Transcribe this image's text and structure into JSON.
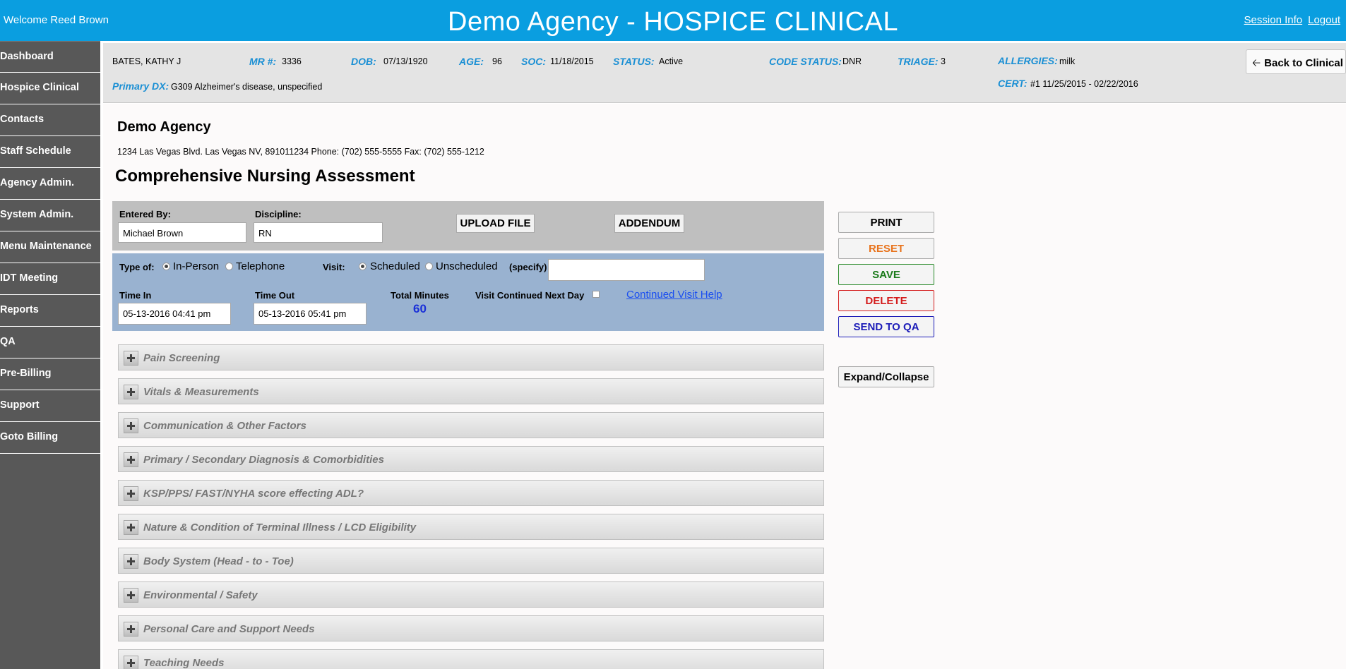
{
  "header": {
    "welcome": "Welcome Reed Brown",
    "title": "Demo Agency - HOSPICE CLINICAL",
    "session_info": "Session Info",
    "logout": "Logout"
  },
  "sidebar": {
    "items": [
      {
        "label": "Dashboard"
      },
      {
        "label": "Hospice Clinical"
      },
      {
        "label": "Contacts"
      },
      {
        "label": "Staff Schedule"
      },
      {
        "label": "Agency Admin."
      },
      {
        "label": "System Admin."
      },
      {
        "label": "Menu Maintenance"
      },
      {
        "label": "IDT Meeting"
      },
      {
        "label": "Reports"
      },
      {
        "label": "QA"
      },
      {
        "label": "Pre-Billing"
      },
      {
        "label": "Support"
      },
      {
        "label": "Goto Billing"
      }
    ]
  },
  "patient": {
    "name": "BATES, KATHY J",
    "mr_label": "MR #:",
    "mr": "3336",
    "dob_label": "DOB:",
    "dob": "07/13/1920",
    "age_label": "AGE:",
    "age": "96",
    "soc_label": "SOC:",
    "soc": "11/18/2015",
    "status_label": "STATUS:",
    "status": "Active",
    "code_status_label": "CODE STATUS:",
    "code_status": "DNR",
    "triage_label": "TRIAGE:",
    "triage": "3",
    "allergies_label": "ALLERGIES:",
    "allergies": "milk",
    "primary_dx_label": "Primary DX:",
    "primary_dx": "G309 Alzheimer's disease, unspecified",
    "cert_label": "CERT:",
    "cert": "#1 11/25/2015 - 02/22/2016",
    "back_button": "Back to Clinical"
  },
  "agency": {
    "name": "Demo Agency",
    "address": "1234 Las Vegas Blvd. Las Vegas NV, 891011234 Phone: (702) 555-5555 Fax: (702) 555-1212"
  },
  "page_title": "Comprehensive Nursing Assessment",
  "form": {
    "entered_by_label": "Entered By:",
    "entered_by": "Michael Brown",
    "discipline_label": "Discipline:",
    "discipline": "RN",
    "upload_button": "UPLOAD FILE",
    "addendum_button": "ADDENDUM",
    "type_of_label": "Type of:",
    "type_in_person": "In-Person",
    "type_telephone": "Telephone",
    "visit_label": "Visit:",
    "visit_scheduled": "Scheduled",
    "visit_unscheduled": "Unscheduled",
    "specify_label": "(specify)",
    "specify_value": "",
    "time_in_label": "Time In",
    "time_in": "05-13-2016 04:41 pm",
    "time_out_label": "Time Out",
    "time_out": "05-13-2016 05:41 pm",
    "total_minutes_label": "Total Minutes",
    "total_minutes": "60",
    "visit_continued_label": "Visit Continued Next Day",
    "continued_help_link": "Continued Visit Help"
  },
  "sections": [
    {
      "title": "Pain Screening"
    },
    {
      "title": "Vitals & Measurements"
    },
    {
      "title": "Communication & Other Factors"
    },
    {
      "title": "Primary / Secondary Diagnosis & Comorbidities"
    },
    {
      "title": "KSP/PPS/ FAST/NYHA score effecting ADL?"
    },
    {
      "title": "Nature & Condition of Terminal Illness / LCD Eligibility"
    },
    {
      "title": "Body System (Head - to - Toe)"
    },
    {
      "title": "Environmental / Safety"
    },
    {
      "title": "Personal Care and Support Needs"
    },
    {
      "title": "Teaching Needs"
    }
  ],
  "actions": {
    "print": "PRINT",
    "reset": "RESET",
    "save": "SAVE",
    "delete": "DELETE",
    "send_to_qa": "SEND TO QA",
    "expand_collapse": "Expand/Collapse"
  },
  "colors": {
    "header_bg": "#0a9ee0",
    "sidebar_bg": "#585858",
    "reset_text": "#e8731c",
    "save_text": "#1a7a1a",
    "delete_text": "#d41c1c",
    "send_qa_text": "#1c1cb8",
    "label_blue": "#1a8fd4"
  }
}
